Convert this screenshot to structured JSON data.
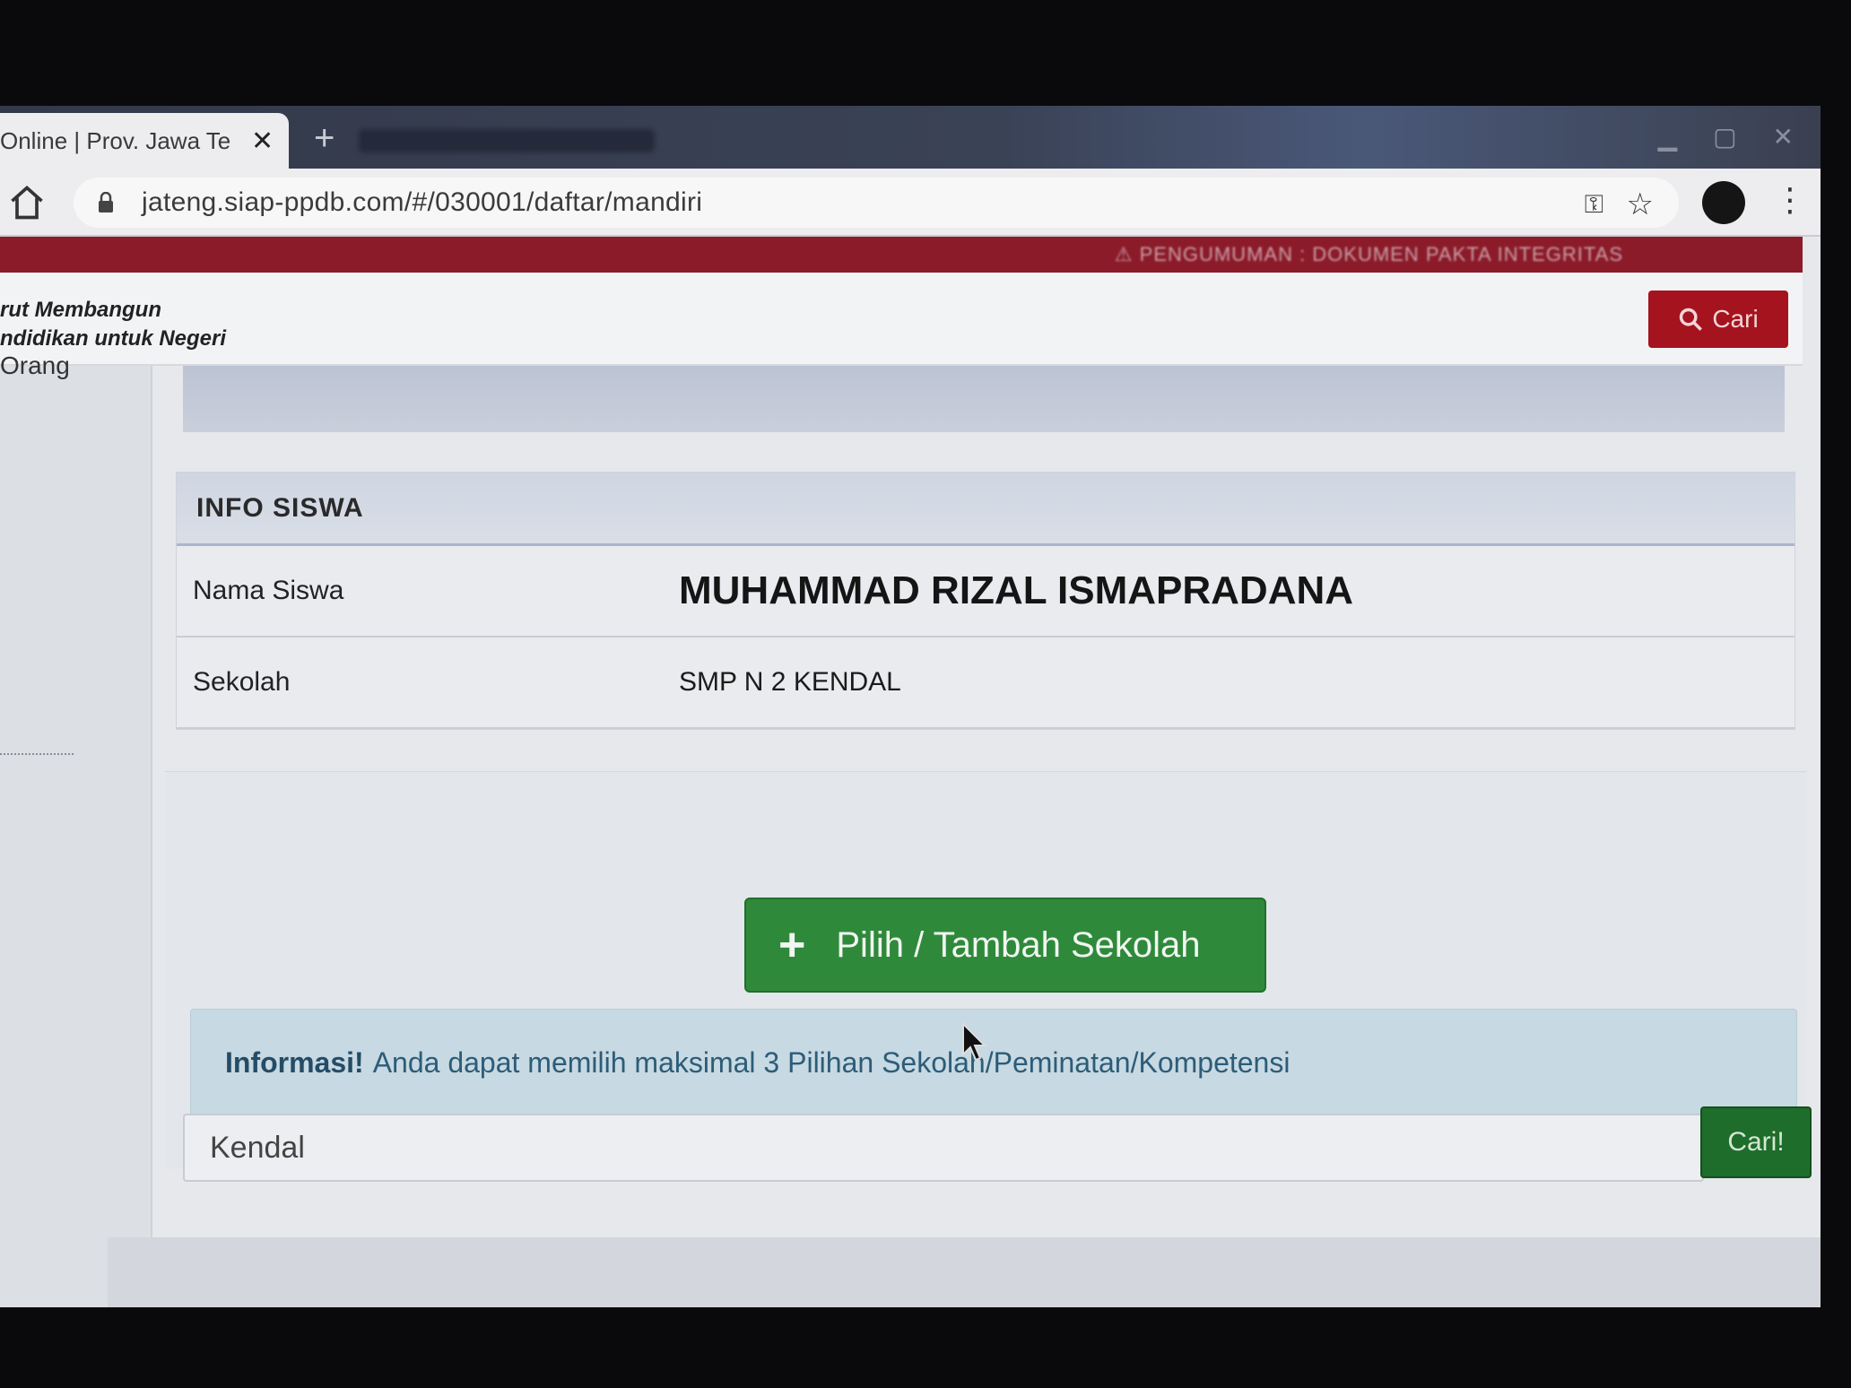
{
  "browser": {
    "tab_title": "Online | Prov. Jawa Te",
    "tab_close": "✕",
    "new_tab": "+",
    "url": "jateng.siap-ppdb.com/#/030001/daftar/mandiri"
  },
  "announcement": "⚠ PENGUMUMAN : DOKUMEN PAKTA INTEGRITAS",
  "header": {
    "tagline_line1": "rut Membangun",
    "tagline_line2": "ndidikan untuk Negeri",
    "search_button": "Cari"
  },
  "sidebar": {
    "partial_text": "Orang"
  },
  "info_siswa": {
    "title": "INFO SISWA",
    "rows": [
      {
        "label": "Nama Siswa",
        "value": "MUHAMMAD RIZAL ISMAPRADANA"
      },
      {
        "label": "Sekolah",
        "value": "SMP N 2 KENDAL"
      }
    ]
  },
  "actions": {
    "add_school_label": "Pilih / Tambah Sekolah",
    "add_icon": "+"
  },
  "alert": {
    "strong": "Informasi!",
    "text": "Anda dapat memilih maksimal 3 Pilihan Sekolah/Peminatan/Kompetensi"
  },
  "school_search": {
    "value": "Kendal",
    "button": "Cari!"
  },
  "colors": {
    "announcement_bg": "#8c1b2a",
    "search_button": "#a5131f",
    "add_button": "#2e8a3a",
    "alert_bg": "#c7d9e2"
  }
}
